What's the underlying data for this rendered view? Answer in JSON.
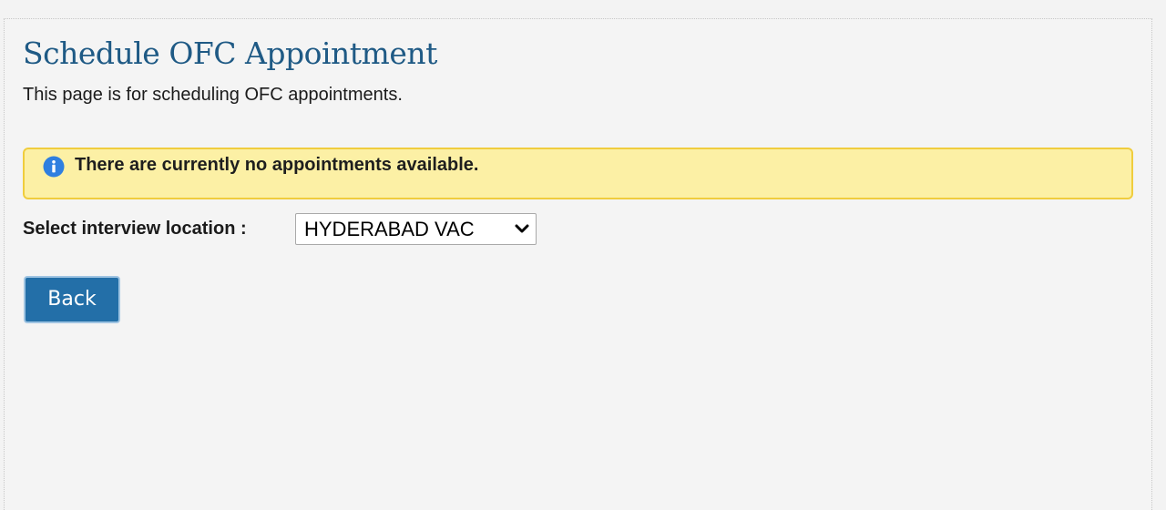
{
  "header": {
    "title": "Schedule OFC Appointment",
    "description": "This page is for scheduling OFC appointments."
  },
  "alert": {
    "icon": "info-icon",
    "message": "There are currently no appointments available.",
    "background_color": "#fcf0a5",
    "border_color": "#f0cd3d"
  },
  "location": {
    "label": "Select interview location :",
    "selected": "HYDERABAD VAC"
  },
  "actions": {
    "back_label": "Back",
    "button_color": "#236fa8"
  },
  "colors": {
    "title": "#1f5a85",
    "page_background": "#f4f4f4"
  }
}
